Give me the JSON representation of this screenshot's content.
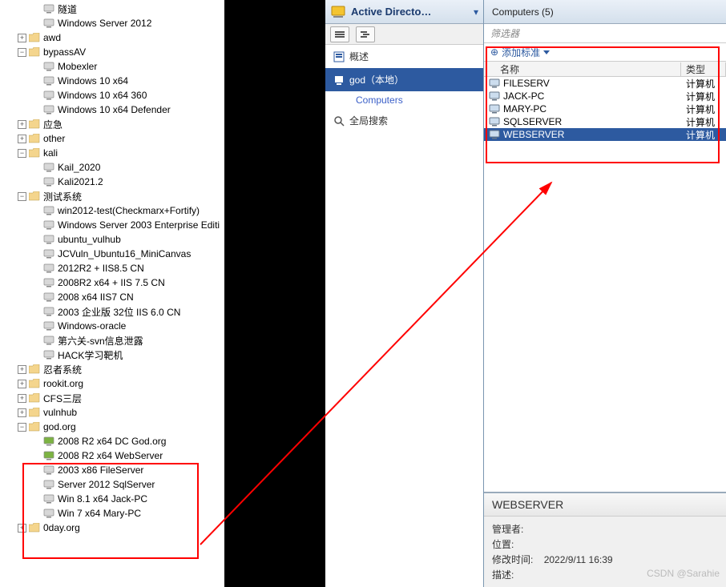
{
  "tree": [
    {
      "depth": "d2",
      "exp": "",
      "icon": "vm",
      "label": "隧道"
    },
    {
      "depth": "d2",
      "exp": "",
      "icon": "vm",
      "label": "Windows Server 2012"
    },
    {
      "depth": "d1",
      "exp": "+",
      "icon": "folder",
      "label": "awd"
    },
    {
      "depth": "d1",
      "exp": "−",
      "icon": "folder",
      "label": "bypassAV"
    },
    {
      "depth": "d2",
      "exp": "",
      "icon": "vm",
      "label": "Mobexler"
    },
    {
      "depth": "d2",
      "exp": "",
      "icon": "vm",
      "label": "Windows 10 x64"
    },
    {
      "depth": "d2",
      "exp": "",
      "icon": "vm",
      "label": "Windows 10 x64 360"
    },
    {
      "depth": "d2",
      "exp": "",
      "icon": "vm",
      "label": "Windows 10 x64 Defender"
    },
    {
      "depth": "d1",
      "exp": "+",
      "icon": "folder",
      "label": "应急"
    },
    {
      "depth": "d1",
      "exp": "+",
      "icon": "folder",
      "label": "other"
    },
    {
      "depth": "d1",
      "exp": "−",
      "icon": "folder",
      "label": "kali"
    },
    {
      "depth": "d2",
      "exp": "",
      "icon": "vm",
      "label": "Kail_2020"
    },
    {
      "depth": "d2",
      "exp": "",
      "icon": "vm",
      "label": "Kali2021.2"
    },
    {
      "depth": "d1",
      "exp": "−",
      "icon": "folder",
      "label": "测试系统"
    },
    {
      "depth": "d2",
      "exp": "",
      "icon": "vm",
      "label": "win2012-test(Checkmarx+Fortify)"
    },
    {
      "depth": "d2",
      "exp": "",
      "icon": "vm",
      "label": "Windows Server 2003 Enterprise Editi"
    },
    {
      "depth": "d2",
      "exp": "",
      "icon": "vm",
      "label": "ubuntu_vulhub"
    },
    {
      "depth": "d2",
      "exp": "",
      "icon": "vm",
      "label": "JCVuln_Ubuntu16_MiniCanvas"
    },
    {
      "depth": "d2",
      "exp": "",
      "icon": "vm",
      "label": "2012R2 + IIS8.5 CN"
    },
    {
      "depth": "d2",
      "exp": "",
      "icon": "vm",
      "label": "2008R2 x64 + IIS 7.5 CN"
    },
    {
      "depth": "d2",
      "exp": "",
      "icon": "vm",
      "label": "2008 x64 IIS7 CN"
    },
    {
      "depth": "d2",
      "exp": "",
      "icon": "vm",
      "label": "2003 企业版 32位 IIS 6.0 CN"
    },
    {
      "depth": "d2",
      "exp": "",
      "icon": "vm",
      "label": "Windows-oracle"
    },
    {
      "depth": "d2",
      "exp": "",
      "icon": "vm",
      "label": "第六关-svn信息泄露"
    },
    {
      "depth": "d2",
      "exp": "",
      "icon": "vm",
      "label": "HACK学习靶机"
    },
    {
      "depth": "d1",
      "exp": "+",
      "icon": "folder",
      "label": "忍者系统"
    },
    {
      "depth": "d1",
      "exp": "+",
      "icon": "folder",
      "label": "rookit.org"
    },
    {
      "depth": "d1",
      "exp": "+",
      "icon": "folder",
      "label": "CFS三层"
    },
    {
      "depth": "d1",
      "exp": "+",
      "icon": "folder",
      "label": "vulnhub"
    },
    {
      "depth": "d1",
      "exp": "−",
      "icon": "folder",
      "label": "god.org"
    },
    {
      "depth": "d2",
      "exp": "",
      "icon": "vm",
      "label": "2008 R2 x64 DC God.org",
      "on": true
    },
    {
      "depth": "d2",
      "exp": "",
      "icon": "vm",
      "label": "2008 R2 x64 WebServer",
      "on": true
    },
    {
      "depth": "d2",
      "exp": "",
      "icon": "vm",
      "label": "2003 x86 FileServer"
    },
    {
      "depth": "d2",
      "exp": "",
      "icon": "vm",
      "label": "Server 2012 SqlServer"
    },
    {
      "depth": "d2",
      "exp": "",
      "icon": "vm",
      "label": "Win 8.1 x64 Jack-PC"
    },
    {
      "depth": "d2",
      "exp": "",
      "icon": "vm",
      "label": "Win 7 x64 Mary-PC"
    },
    {
      "depth": "d1",
      "exp": "+",
      "icon": "folder",
      "label": "0day.org"
    }
  ],
  "ad": {
    "title": "Active Directo…",
    "overview": "概述",
    "domain": "god（本地）",
    "computers": "Computers",
    "global_search": "全局搜索"
  },
  "list": {
    "header": "Computers (5)",
    "filter": "筛选器",
    "add_std": "添加标准",
    "col_name": "名称",
    "col_type": "类型",
    "rows": [
      {
        "name": "FILESERV",
        "type": "计算机"
      },
      {
        "name": "JACK-PC",
        "type": "计算机"
      },
      {
        "name": "MARY-PC",
        "type": "计算机"
      },
      {
        "name": "SQLSERVER",
        "type": "计算机"
      },
      {
        "name": "WEBSERVER",
        "type": "计算机",
        "selected": true
      }
    ]
  },
  "detail": {
    "title": "WEBSERVER",
    "mgr_label": "管理者:",
    "loc_label": "位置:",
    "mod_label": "修改时间:",
    "mod_value": "2022/9/11 16:39",
    "desc_label": "描述:"
  },
  "watermark": "CSDN @Sarahie"
}
